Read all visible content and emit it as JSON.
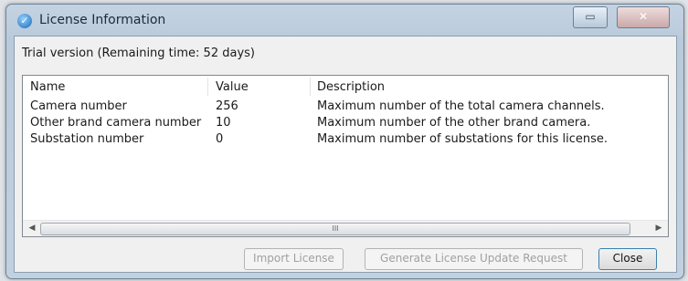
{
  "window": {
    "title": "License Information"
  },
  "trial_text": "Trial version (Remaining time: 52 days)",
  "table": {
    "columns": [
      "Name",
      "Value",
      "Description"
    ],
    "rows": [
      [
        "Camera number",
        "256",
        "Maximum number of the total camera channels."
      ],
      [
        "Other brand camera number",
        "10",
        "Maximum number of the other brand camera."
      ],
      [
        "Substation number",
        "0",
        "Maximum number of substations for this license."
      ]
    ]
  },
  "scrollbar": {
    "thumb_grip": "III"
  },
  "buttons": {
    "import_license": "Import License",
    "generate_request": "Generate License Update Request",
    "close": "Close"
  },
  "icons": {
    "app": "shield-icon",
    "minimize": "minimize-icon",
    "close": "close-icon"
  }
}
